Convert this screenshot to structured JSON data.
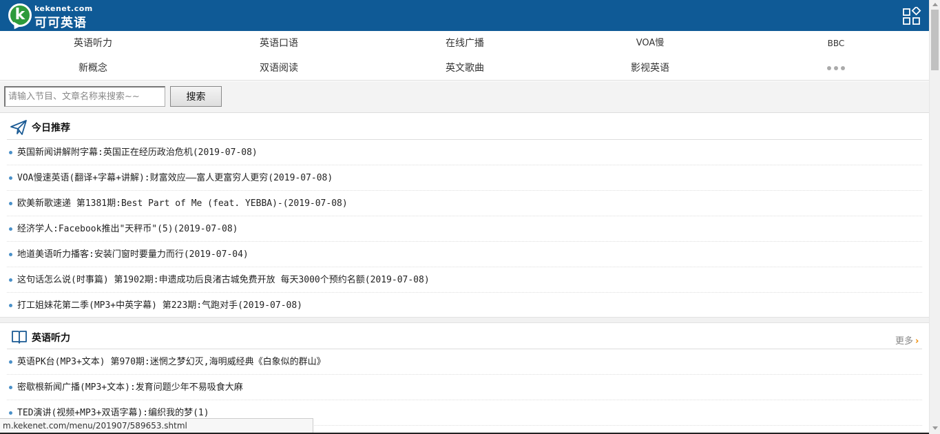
{
  "header": {
    "logo_letter": "k",
    "logo_domain": "kekenet.com",
    "logo_name": "可可英语",
    "menu_icon": "grid-menu-icon",
    "bg_color": "#0f5a96"
  },
  "nav": {
    "row1": [
      "英语听力",
      "英语口语",
      "在线广播",
      "VOA慢",
      "BBC"
    ],
    "row2": [
      "新概念",
      "双语阅读",
      "英文歌曲",
      "影视英语"
    ],
    "more_icon": "more-dots-icon"
  },
  "search": {
    "placeholder": "请输入节目、文章名称来搜索~~",
    "button_label": "搜索"
  },
  "today": {
    "icon": "paper-plane-icon",
    "title": "今日推荐",
    "items": [
      "英国新闻讲解附字幕:英国正在经历政治危机(2019-07-08)",
      "VOA慢速英语(翻译+字幕+讲解):财富效应——富人更富穷人更穷(2019-07-08)",
      "欧美新歌速递 第1381期:Best Part of Me (feat. YEBBA)-(2019-07-08)",
      "经济学人:Facebook推出\"天秤币\"(5)(2019-07-08)",
      "地道美语听力播客:安装门窗时要量力而行(2019-07-04)",
      "这句话怎么说(时事篇) 第1902期:申遗成功后良渚古城免费开放 每天3000个预约名额(2019-07-08)",
      "打工姐妹花第二季(MP3+中英字幕) 第223期:气跑对手(2019-07-08)"
    ]
  },
  "listening": {
    "icon": "open-book-icon",
    "title": "英语听力",
    "more_label": "更多",
    "more_arrow": "›",
    "items": [
      "英语PK台(MP3+文本) 第970期:迷惘之梦幻灭,海明威经典《白象似的群山》",
      "密歇根新闻广播(MP3+文本):发育问题少年不易吸食大麻",
      "TED演讲(视频+MP3+双语字幕):编织我的梦(1)"
    ]
  },
  "status_bar": {
    "url": "m.kekenet.com/menu/201907/589653.shtml"
  }
}
